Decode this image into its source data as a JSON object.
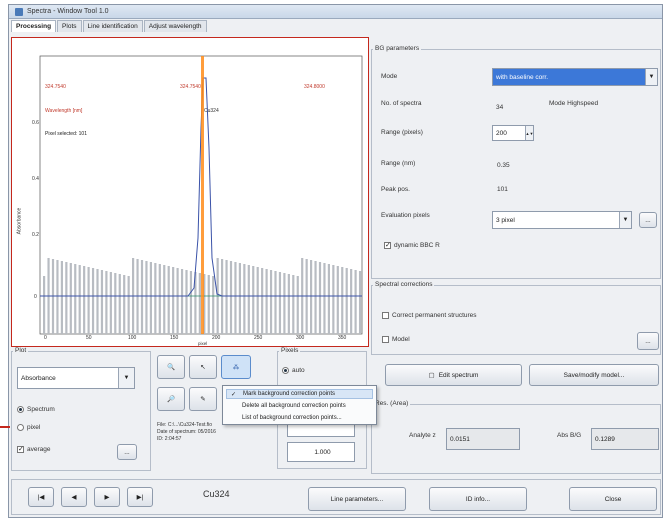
{
  "window": {
    "title": "Spectra - Window Tool 1.0"
  },
  "tabs": [
    "Processing",
    "Plots",
    "Line identification",
    "Adjust wavelength"
  ],
  "plot": {
    "y_ticks": [
      "0.6",
      "0.4",
      "0.2",
      "0"
    ],
    "x_ticks": [
      "0",
      "50",
      "100",
      "150",
      "200",
      "250",
      "300",
      "350"
    ],
    "y_label": "Absorbance",
    "x_label": "pixel",
    "annotations": {
      "left_top": "324.7540",
      "center_top": "324.7540",
      "right_top": "324.8000",
      "left_mid": "Wavelength [nm]",
      "left_low": "Pixel selected: 101",
      "center_mid": "Cu324"
    }
  },
  "plot_settings": {
    "group": "Plot",
    "mode": "Absorbance",
    "option_spectrum": "Spectrum",
    "option_pixel": "pixel",
    "option_average": "average",
    "more_btn": "...",
    "pixels_group": "Pixels",
    "pixels_auto": "auto",
    "pixel_value_1": "",
    "pixel_value_2": "1.000",
    "info_lines": [
      "File: C:\\...\\Cu324-Test.fio",
      "Date of spectrum: 05/2016",
      "ID: 2:04:57"
    ]
  },
  "context_menu": {
    "items": [
      "Mark background correction points",
      "Delete all background correction points",
      "List of background correction points..."
    ]
  },
  "bg_params": {
    "group": "BG parameters",
    "mode_label": "Mode",
    "mode_value": "with baseline corr.",
    "spectra_label": "No. of spectra",
    "spectra_value": "34",
    "spectra_mode": "Mode Highspeed",
    "range_pixels_label": "Range (pixels)",
    "range_pixels_value": "200",
    "range_nm_label": "Range (nm)",
    "range_nm_value": "0.35",
    "peak_pos_label": "Peak pos.",
    "peak_pos_value": "101",
    "eval_pixels_label": "Evaluation pixels",
    "eval_pixels_value": "3 pixel",
    "more_btn": "...",
    "dynamic_label": "dynamic BBC R"
  },
  "spectral_corrections": {
    "group": "Spectral corrections",
    "correct_label": "Correct permanent structures",
    "model_label": "Model",
    "more_btn": "...",
    "edit_btn": "Edit spectrum",
    "save_btn": "Save/modify model..."
  },
  "results": {
    "group": "Res. (Area)",
    "analyte_label": "Analyte z",
    "analyte_value": "0.0151",
    "abs_label": "Abs B/G",
    "abs_value": "0.1289"
  },
  "footer": {
    "nav": [
      "|◀",
      "◀",
      "▶",
      "▶|"
    ],
    "line_name": "Cu324",
    "line_params_btn": "Line parameters...",
    "info_btn": "ID info...",
    "close_btn": "Close"
  },
  "colors": {
    "peak_line": "#ff8c1a",
    "highlight": "#3c78d8",
    "annotation": "#c0392b"
  }
}
